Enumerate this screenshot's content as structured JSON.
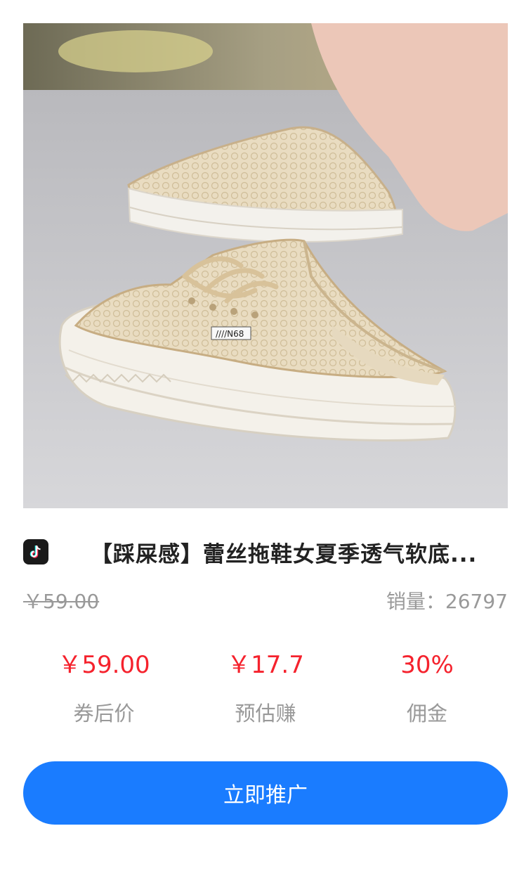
{
  "product": {
    "image_alt": "蕾丝拖鞋",
    "platform_icon": "douyin-icon",
    "title": "【踩屎感】蕾丝拖鞋女夏季透气软底...",
    "original_price": "￥59.00",
    "sales_label": "销量：",
    "sales_count": "26797"
  },
  "stats": [
    {
      "value": "￥59.00",
      "label": "券后价"
    },
    {
      "value": "￥17.7",
      "label": "预估赚"
    },
    {
      "value": "30%",
      "label": "佣金"
    }
  ],
  "colors": {
    "accent_red": "#f5222d",
    "button_blue": "#1a7cff",
    "muted_gray": "#999999"
  },
  "action": {
    "promote_label": "立即推广"
  }
}
